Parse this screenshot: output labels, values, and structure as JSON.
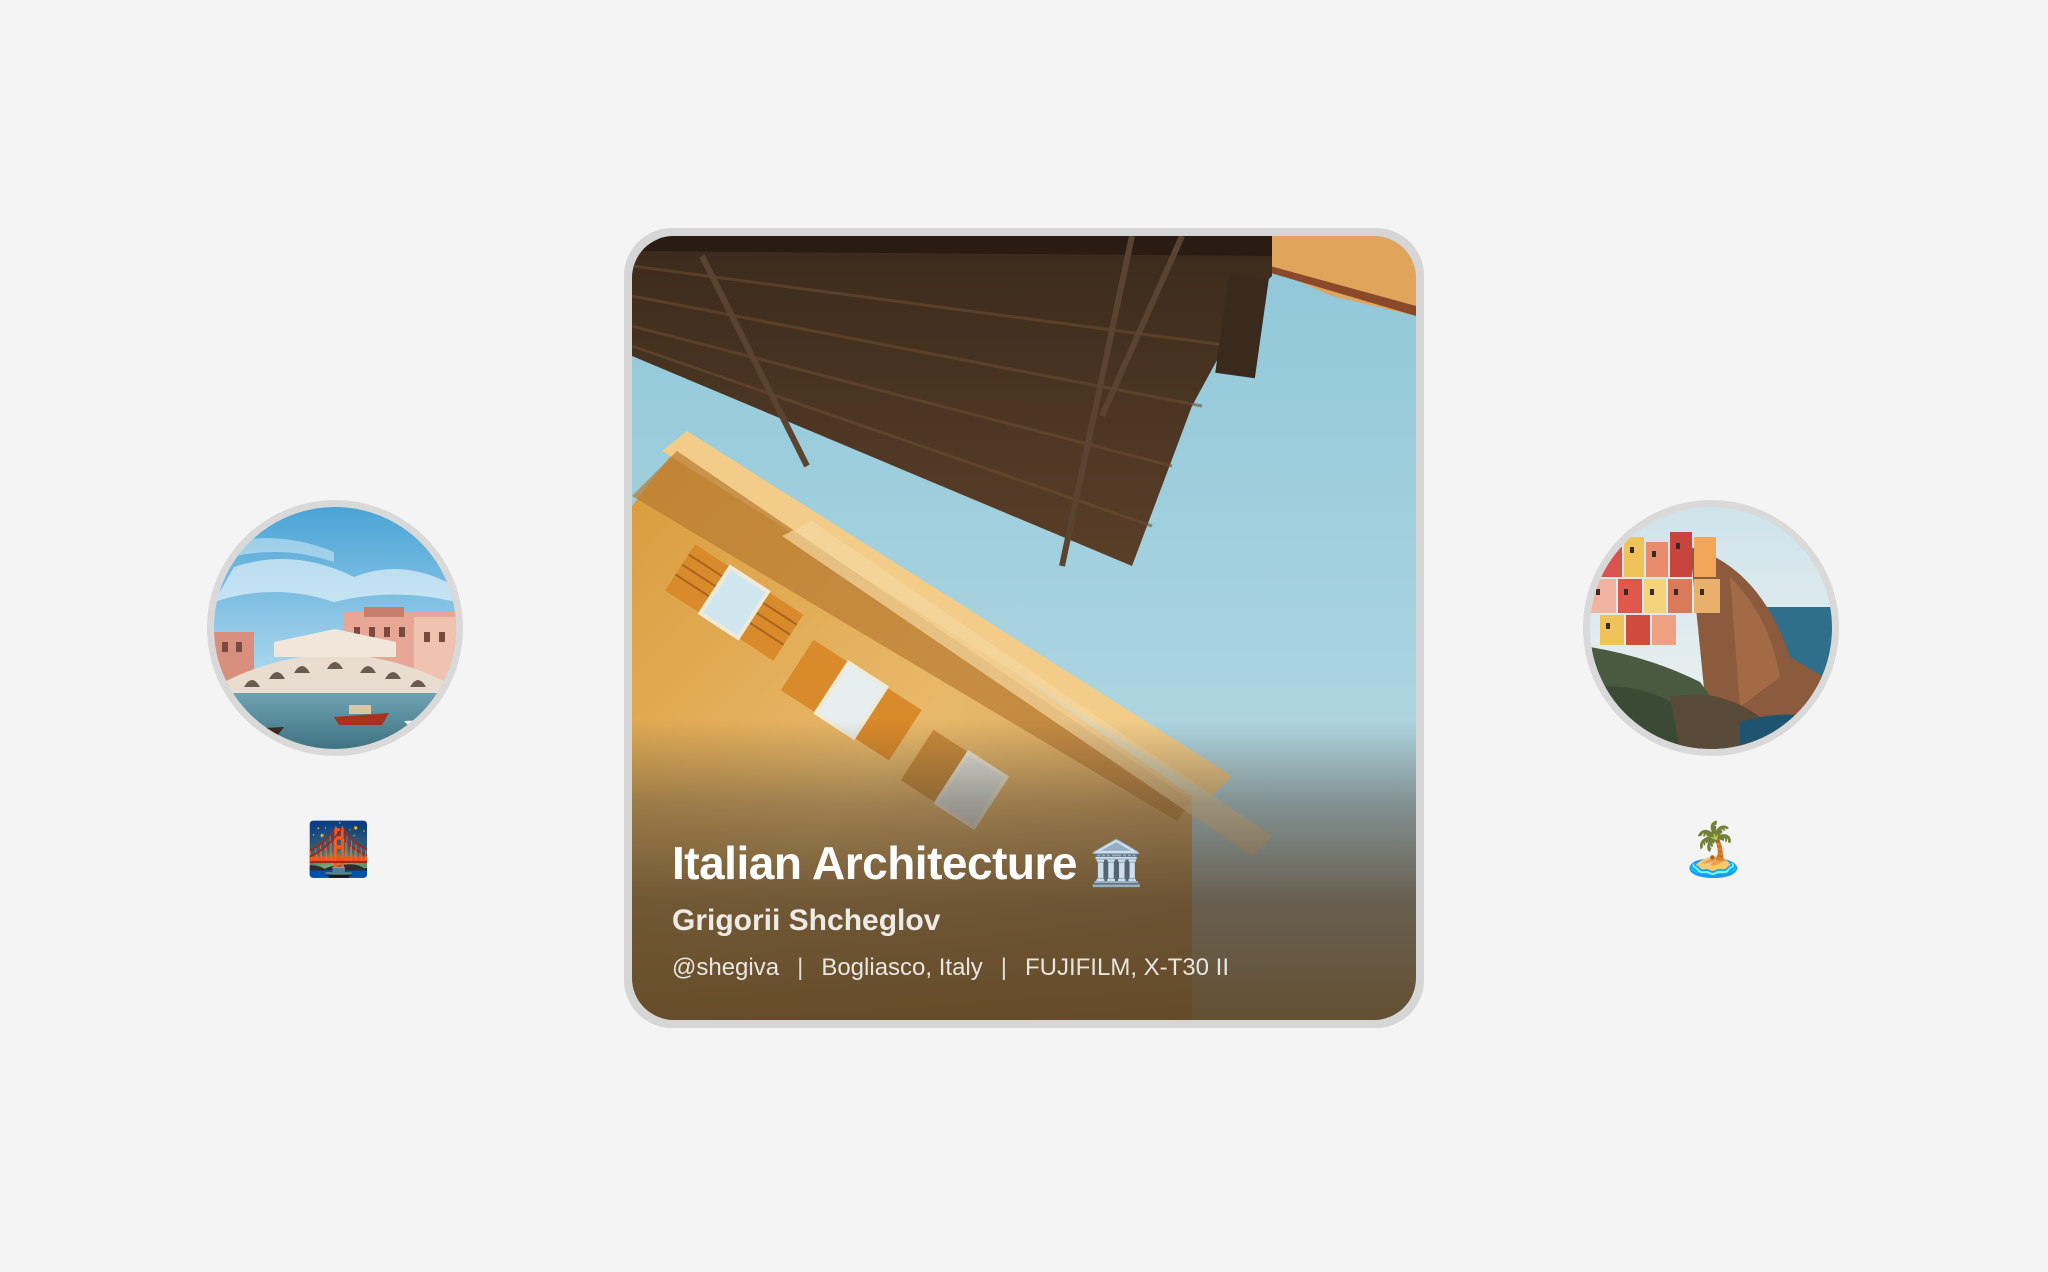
{
  "featured": {
    "title": "Italian Architecture",
    "title_emoji": "🏛️",
    "author": "Grigorii Shcheglov",
    "handle": "@shegiva",
    "location": "Bogliasco, Italy",
    "camera": "FUJIFILM, X-T30 II",
    "separator": "|"
  },
  "left_item": {
    "emoji": "🌉"
  },
  "right_item": {
    "emoji": "🏝️"
  },
  "colors": {
    "background": "#f4f4f4",
    "card_border": "#d6d6d6",
    "sky": "#a9d3df",
    "overlay_warm": "#5c4424"
  }
}
